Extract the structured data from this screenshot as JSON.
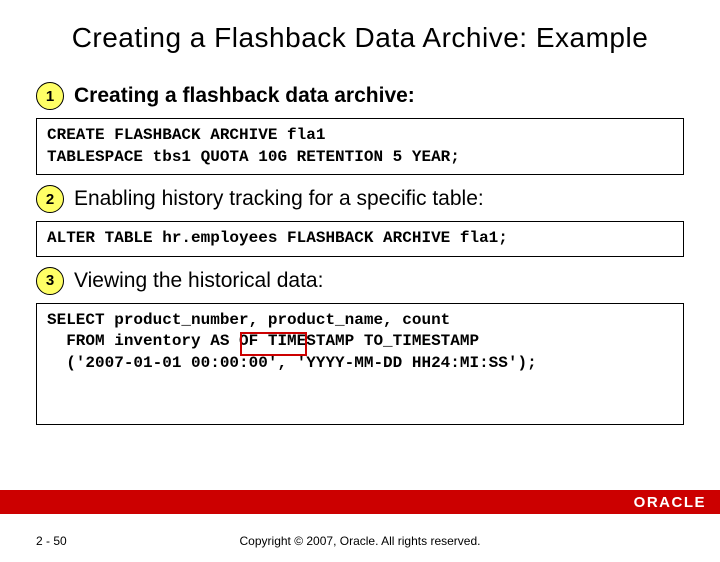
{
  "title": "Creating a Flashback Data Archive: Example",
  "steps": [
    {
      "num": "1",
      "text": "Creating a flashback data archive:",
      "bold": true,
      "code": "CREATE FLASHBACK ARCHIVE fla1\nTABLESPACE tbs1 QUOTA 10G RETENTION 5 YEAR;"
    },
    {
      "num": "2",
      "text": "Enabling history tracking for a specific table:",
      "bold": false,
      "code": "ALTER TABLE hr.employees FLASHBACK ARCHIVE fla1;"
    },
    {
      "num": "3",
      "text": "Viewing the historical data:",
      "bold": false,
      "code": "SELECT product_number, product_name, count\n  FROM inventory AS OF TIMESTAMP TO_TIMESTAMP\n  ('2007-01-01 00:00:00', 'YYYY-MM-DD HH24:MI:SS');"
    }
  ],
  "footer": {
    "logo": "ORACLE",
    "page": "2 - 50",
    "copyright": "Copyright © 2007, Oracle. All rights reserved."
  }
}
